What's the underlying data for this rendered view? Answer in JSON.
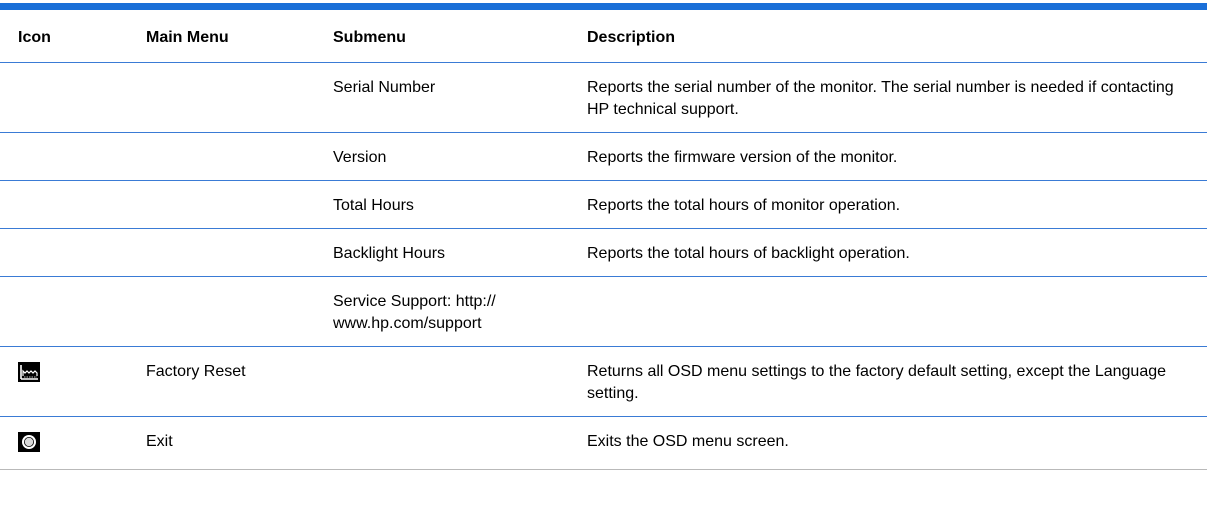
{
  "table": {
    "headers": {
      "icon": "Icon",
      "main_menu": "Main Menu",
      "submenu": "Submenu",
      "description": "Description"
    },
    "rows": [
      {
        "icon": "",
        "main_menu": "",
        "submenu": "Serial Number",
        "description": "Reports the serial number of the monitor. The serial number is needed if contacting HP technical support."
      },
      {
        "icon": "",
        "main_menu": "",
        "submenu": "Version",
        "description": "Reports the firmware version of the monitor."
      },
      {
        "icon": "",
        "main_menu": "",
        "submenu": "Total Hours",
        "description": "Reports the total hours of monitor operation."
      },
      {
        "icon": "",
        "main_menu": "",
        "submenu": "Backlight Hours",
        "description": "Reports the total hours of backlight operation."
      },
      {
        "icon": "",
        "main_menu": "",
        "submenu": "Service Support: http:// www.hp.com/support",
        "description": ""
      },
      {
        "icon": "factory-reset-icon",
        "main_menu": "Factory Reset",
        "submenu": "",
        "description": "Returns all OSD menu settings to the factory default setting, except the Language setting."
      },
      {
        "icon": "exit-icon",
        "main_menu": "Exit",
        "submenu": "",
        "description": "Exits the OSD menu screen."
      }
    ]
  },
  "colors": {
    "accent_bar": "#1a6fd8",
    "row_divider": "#3a7bd5"
  }
}
